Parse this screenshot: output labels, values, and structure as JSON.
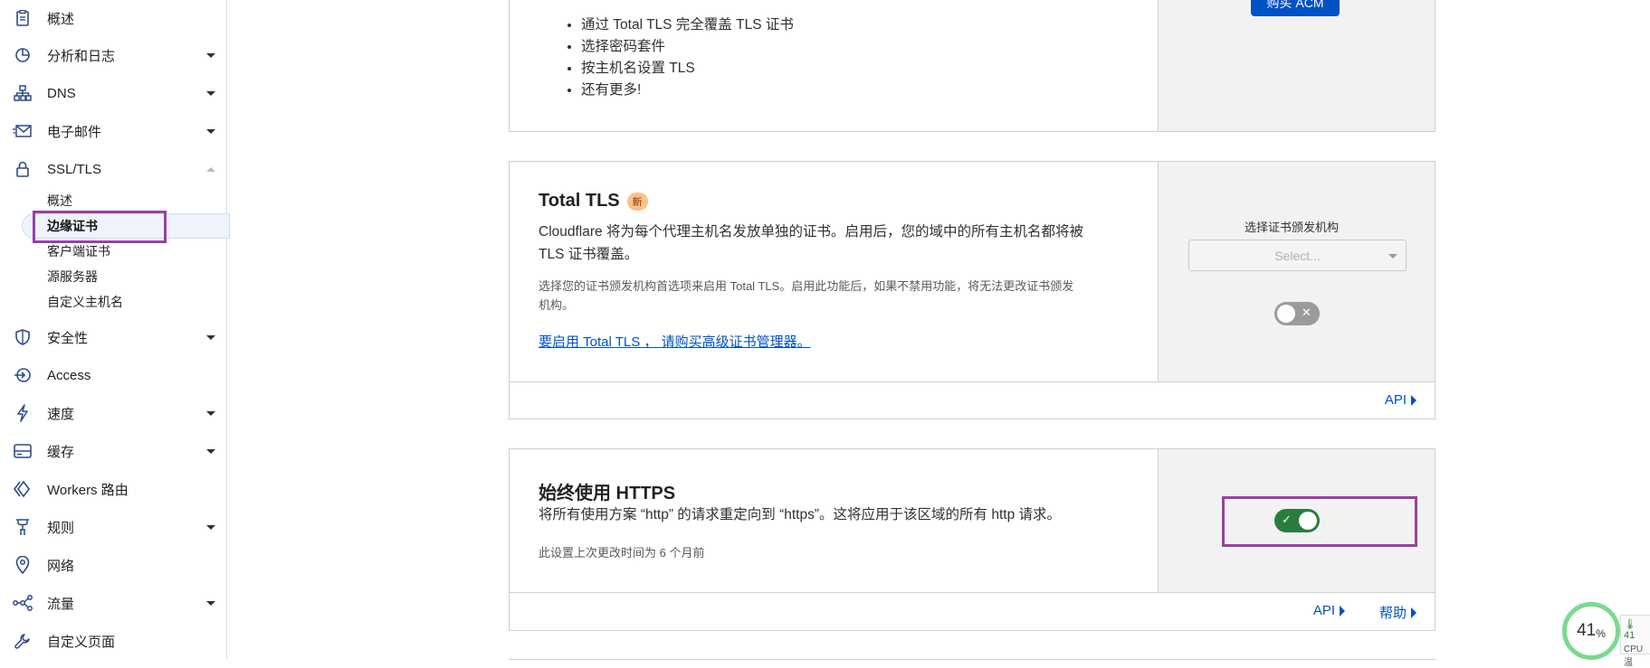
{
  "sidebar": {
    "items": [
      {
        "label": "概述",
        "icon": "document-icon",
        "caret": "none"
      },
      {
        "label": "分析和日志",
        "icon": "pie-chart-icon",
        "caret": "down"
      },
      {
        "label": "DNS",
        "icon": "network-icon",
        "caret": "down"
      },
      {
        "label": "电子邮件",
        "icon": "email-icon",
        "caret": "down"
      },
      {
        "label": "SSL/TLS",
        "icon": "lock-icon",
        "caret": "up"
      },
      {
        "label": "安全性",
        "icon": "shield-icon",
        "caret": "down"
      },
      {
        "label": "Access",
        "icon": "access-icon",
        "caret": "none"
      },
      {
        "label": "速度",
        "icon": "lightning-icon",
        "caret": "down"
      },
      {
        "label": "缓存",
        "icon": "storage-icon",
        "caret": "down"
      },
      {
        "label": "Workers 路由",
        "icon": "workers-icon",
        "caret": "none"
      },
      {
        "label": "规则",
        "icon": "rules-icon",
        "caret": "down"
      },
      {
        "label": "网络",
        "icon": "location-pin-icon",
        "caret": "none"
      },
      {
        "label": "流量",
        "icon": "traffic-icon",
        "caret": "down"
      },
      {
        "label": "自定义页面",
        "icon": "wrench-icon",
        "caret": "none"
      }
    ],
    "ssl_sub": [
      "概述",
      "边缘证书",
      "客户端证书",
      "源服务器",
      "自定义主机名"
    ],
    "active_sub": "边缘证书"
  },
  "acm_card": {
    "bullets": [
      "通过 Total TLS 完全覆盖 TLS 证书",
      "选择密码套件",
      "按主机名设置 TLS",
      "还有更多!"
    ],
    "buy_button": "购买 ACM"
  },
  "total_tls": {
    "title": "Total TLS",
    "badge": "新",
    "desc_line1": "Cloudflare 将为每个代理主机名发放单独的证书。启用后，您的域中的所有主机名都将被",
    "desc_line2": "TLS 证书覆盖。",
    "note_line1": "选择您的证书颁发机构首选项来启用 Total TLS。启用此功能后，如果不禁用功能，将无法更改证书颁发",
    "note_line2": "机构。",
    "link": "要启用 Total TLS ， 请购买高级证书管理器。",
    "select_label": "选择证书颁发机构",
    "select_placeholder": "Select...",
    "toggle_state": "off",
    "api_label": "API"
  },
  "always_https": {
    "title": "始终使用 HTTPS",
    "desc": "将所有使用方案 “http” 的请求重定向到 “https”。这将应用于该区域的所有 http 请求。",
    "note": "此设置上次更改时间为 6 个月前",
    "toggle_state": "on",
    "api_label": "API",
    "help_label": "帮助"
  },
  "cpu_widget": {
    "value": "41",
    "unit": "%",
    "side_top": "41",
    "side_bottom": "CPU温"
  },
  "colors": {
    "accent": "#0051c3",
    "highlight": "#9b3fa4",
    "toggle_on": "#2a7d3e",
    "badge": "#f9c28b"
  }
}
